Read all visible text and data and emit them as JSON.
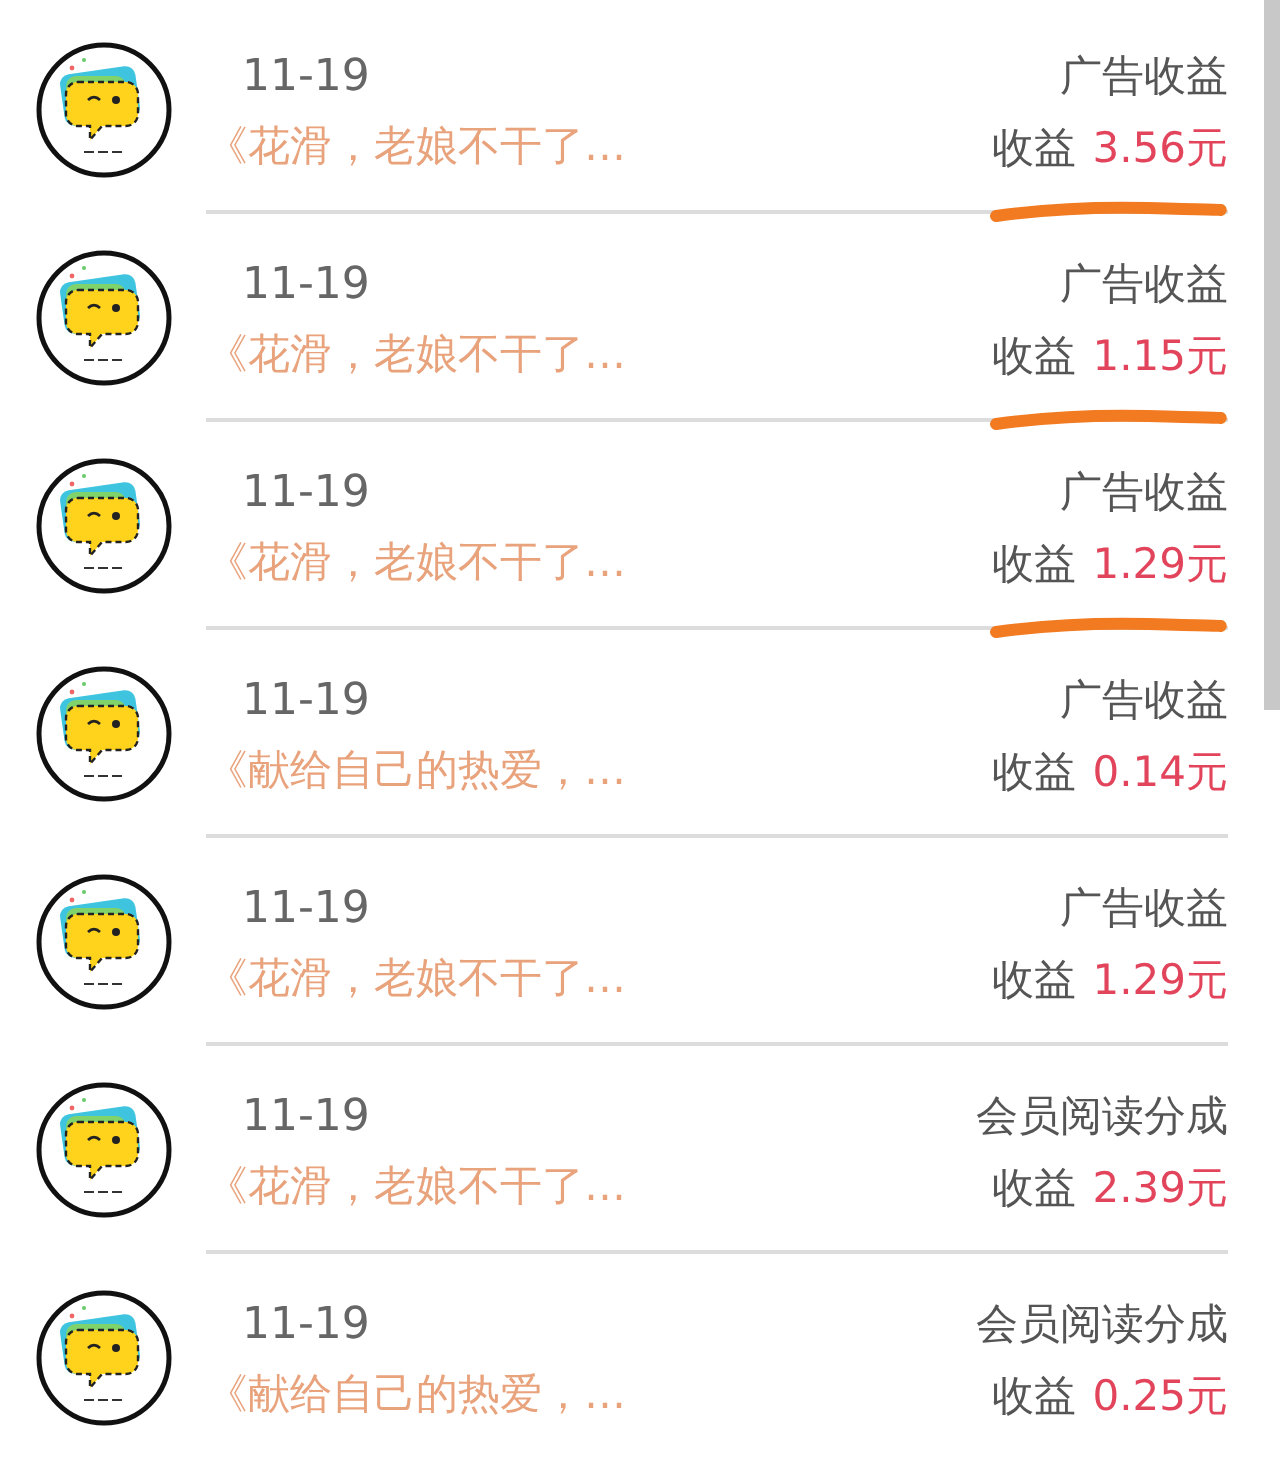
{
  "records": [
    {
      "date": "11-19",
      "title": "《花滑，老娘不干了…",
      "type": "广告收益",
      "amount_label": "收益",
      "amount": "3.56元",
      "underlined": true
    },
    {
      "date": "11-19",
      "title": "《花滑，老娘不干了…",
      "type": "广告收益",
      "amount_label": "收益",
      "amount": "1.15元",
      "underlined": true
    },
    {
      "date": "11-19",
      "title": "《花滑，老娘不干了…",
      "type": "广告收益",
      "amount_label": "收益",
      "amount": "1.29元",
      "underlined": true
    },
    {
      "date": "11-19",
      "title": "《献给自己的热爱，…",
      "type": "广告收益",
      "amount_label": "收益",
      "amount": "0.14元",
      "underlined": false
    },
    {
      "date": "11-19",
      "title": "《花滑，老娘不干了…",
      "type": "广告收益",
      "amount_label": "收益",
      "amount": "1.29元",
      "underlined": false
    },
    {
      "date": "11-19",
      "title": "《花滑，老娘不干了…",
      "type": "会员阅读分成",
      "amount_label": "收益",
      "amount": "2.39元",
      "underlined": false
    },
    {
      "date": "11-19",
      "title": "《献给自己的热爱，…",
      "type": "会员阅读分成",
      "amount_label": "收益",
      "amount": "0.25元",
      "underlined": false
    }
  ]
}
